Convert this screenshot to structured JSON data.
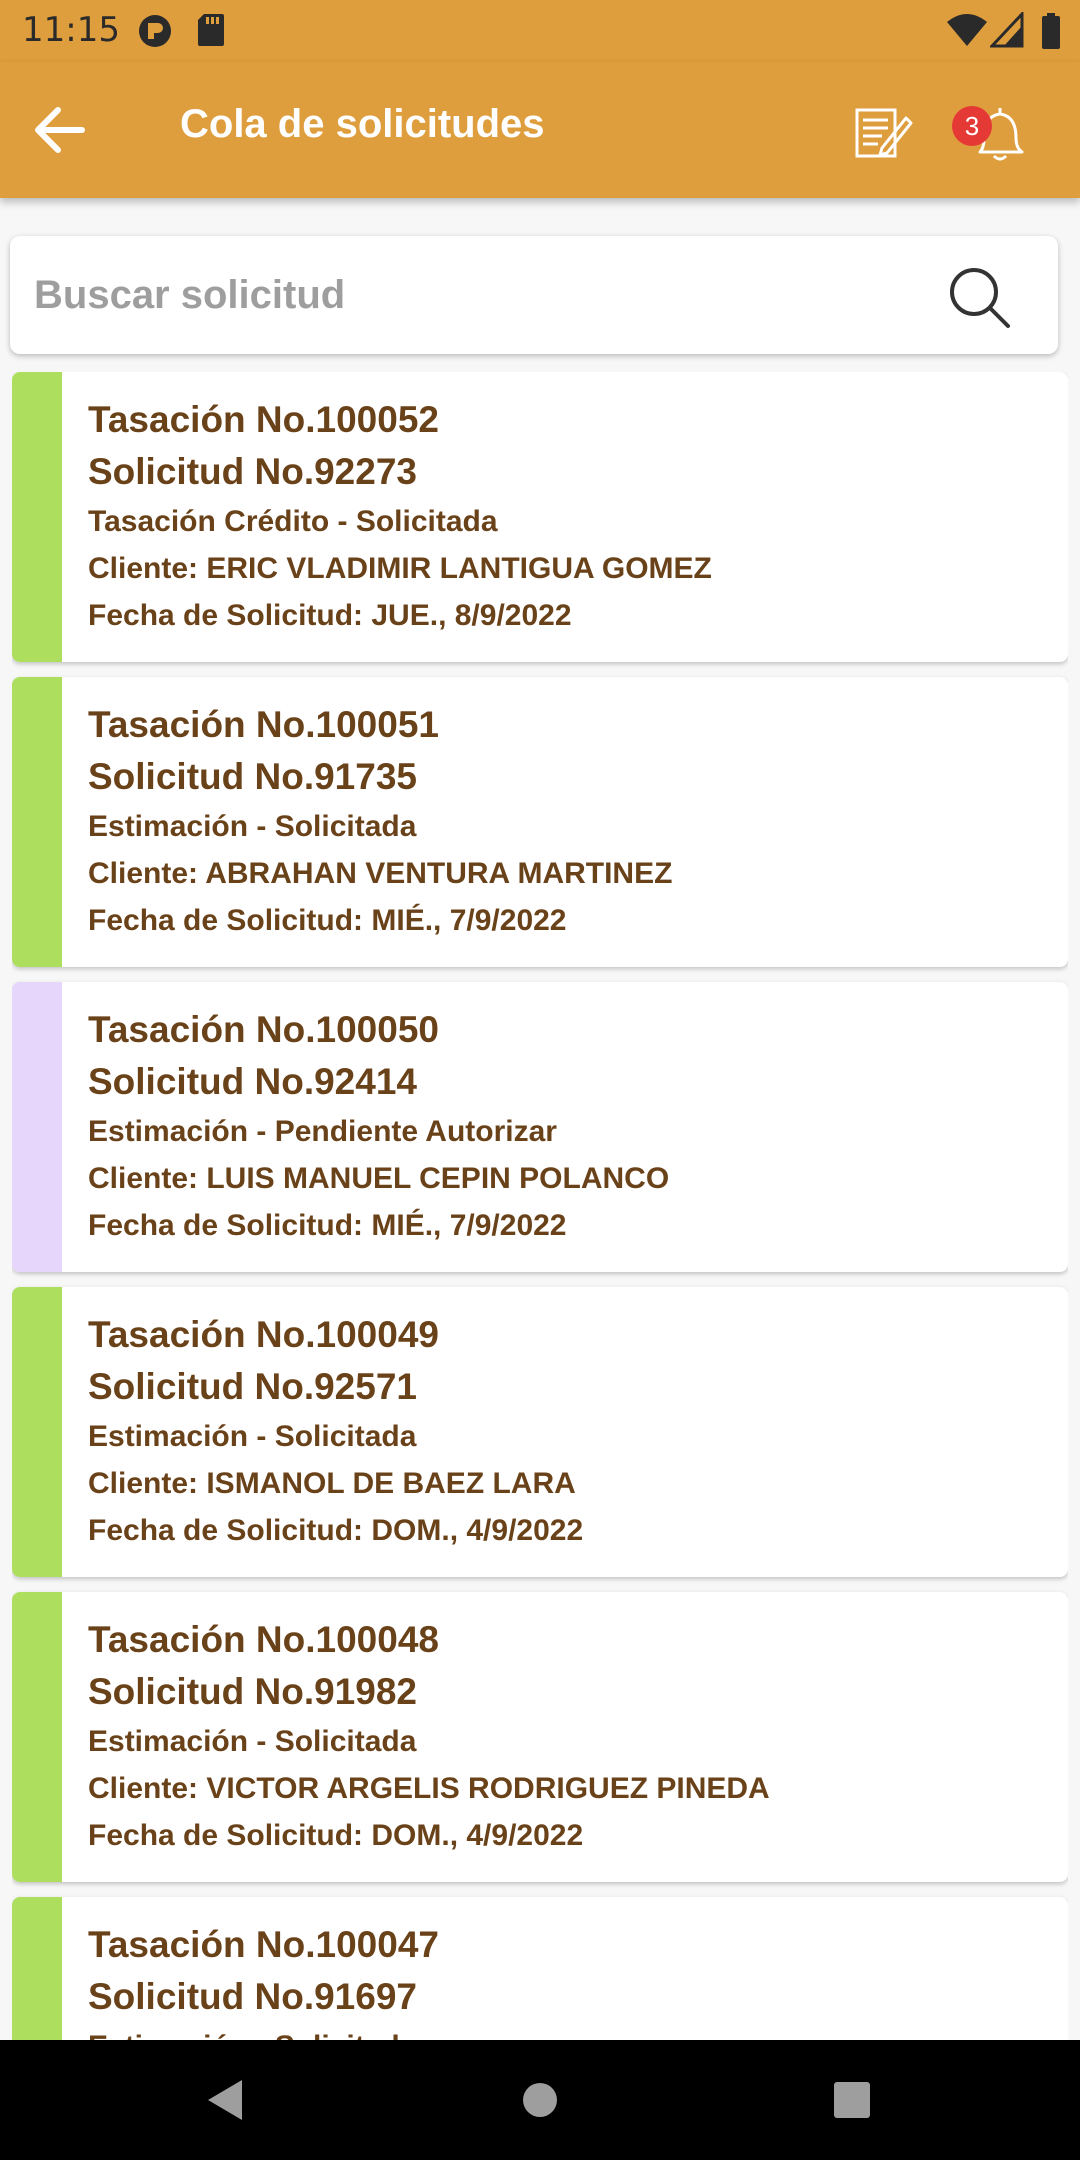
{
  "status_bar": {
    "time": "11:15",
    "left_icons": [
      "headset-icon",
      "sd-card-icon"
    ],
    "right_icons": [
      "wifi-icon",
      "signal-icon",
      "battery-icon"
    ]
  },
  "app_bar": {
    "title": "Cola de solicitudes",
    "notification_count": "3",
    "color": "#df9e3e"
  },
  "search": {
    "placeholder": "Buscar solicitud",
    "value": ""
  },
  "status_colors": {
    "solicitada": "#aede5e",
    "pendiente": "#e6d6fc"
  },
  "requests": [
    {
      "tasacion": "Tasación No.100052",
      "solicitud": "Solicitud No.92273",
      "tipo": "Tasación Crédito - Solicitada",
      "cliente": "Cliente: ERIC VLADIMIR LANTIGUA GOMEZ",
      "fecha": "Fecha de Solicitud:  JUE., 8/9/2022",
      "stripe_color": "#aede5e"
    },
    {
      "tasacion": "Tasación No.100051",
      "solicitud": "Solicitud No.91735",
      "tipo": "Estimación - Solicitada",
      "cliente": "Cliente: ABRAHAN  VENTURA MARTINEZ",
      "fecha": "Fecha de Solicitud:  MIÉ., 7/9/2022",
      "stripe_color": "#aede5e"
    },
    {
      "tasacion": "Tasación No.100050",
      "solicitud": "Solicitud No.92414",
      "tipo": "Estimación - Pendiente Autorizar",
      "cliente": "Cliente: LUIS MANUEL CEPIN POLANCO",
      "fecha": "Fecha de Solicitud:  MIÉ., 7/9/2022",
      "stripe_color": "#e6d6fc"
    },
    {
      "tasacion": "Tasación No.100049",
      "solicitud": "Solicitud No.92571",
      "tipo": "Estimación - Solicitada",
      "cliente": "Cliente: ISMANOL DE BAEZ LARA",
      "fecha": "Fecha de Solicitud:  DOM., 4/9/2022",
      "stripe_color": "#aede5e"
    },
    {
      "tasacion": "Tasación No.100048",
      "solicitud": "Solicitud No.91982",
      "tipo": "Estimación - Solicitada",
      "cliente": "Cliente: VICTOR ARGELIS RODRIGUEZ PINEDA",
      "fecha": "Fecha de Solicitud:  DOM., 4/9/2022",
      "stripe_color": "#aede5e"
    },
    {
      "tasacion": "Tasación No.100047",
      "solicitud": "Solicitud No.91697",
      "tipo": "Estimación - Solicitada",
      "cliente": "",
      "fecha": "",
      "stripe_color": "#aede5e"
    }
  ]
}
